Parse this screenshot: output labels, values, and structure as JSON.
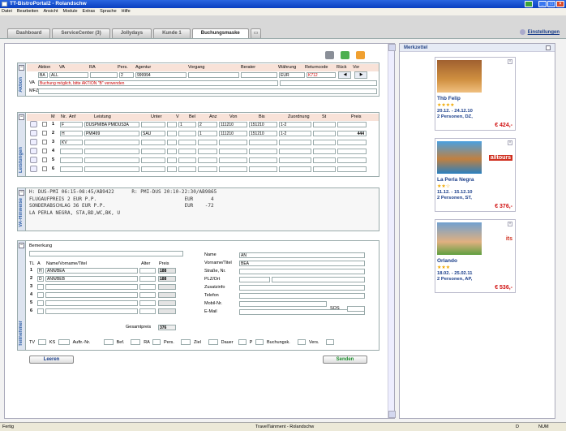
{
  "window": {
    "title": "TT-BistroPortal2 - Rolandschw"
  },
  "menu": [
    "Datei",
    "Bearbeiten",
    "Ansicht",
    "Module",
    "Extras",
    "Sprache",
    "Hilfe"
  ],
  "tabs": [
    "Dashboard",
    "ServiceCenter (3)",
    "Jollydays",
    "Kunde 1",
    "Buchungsmaske"
  ],
  "settings_label": "Einstellungen",
  "aktion": {
    "section_label": "Aktion",
    "headers": [
      "Aktion",
      "VA",
      "RA",
      "Pers.",
      "Agentur",
      "Vorgang",
      "Berater",
      "Währung",
      "Returncode",
      "Rück",
      "Vor"
    ],
    "row": {
      "aktion": "BA",
      "va": "ALL",
      "ra": "",
      "pers": "2",
      "agentur": "999994",
      "vorgang": "",
      "berater": "",
      "waehrung": "EUR",
      "returncode": "K712"
    },
    "va_label": "VA",
    "va_message": "Buchung möglich, bitte AKTION \"B\" verwenden",
    "mfz_label": "MFZ"
  },
  "leistungen": {
    "section_label": "Leistungen",
    "headers": [
      "M",
      "Nr.",
      "Anf",
      "Leistung",
      "Unter",
      "V",
      "Bel",
      "Anz",
      "Von",
      "Bis",
      "Zuordnung",
      "St",
      "Preis"
    ],
    "rows": [
      {
        "nr": "1",
        "anf": "F",
        "leistung": "DUSPMIBA PMIDUS3A",
        "unter": "",
        "bel": "1",
        "anz": "2",
        "von": "111210",
        "bis": "151210",
        "zuordnung": "1-2",
        "preis": ""
      },
      {
        "nr": "2",
        "anf": "H",
        "leistung": "PMI499",
        "unter": "SAU",
        "bel": "",
        "anz": "1",
        "von": "111210",
        "bis": "151210",
        "zuordnung": "1-2",
        "preis": "444"
      },
      {
        "nr": "3",
        "anf": "KV",
        "leistung": "",
        "unter": "",
        "bel": "",
        "anz": "",
        "von": "",
        "bis": "",
        "zuordnung": "",
        "preis": ""
      },
      {
        "nr": "4",
        "anf": "",
        "leistung": "",
        "unter": "",
        "bel": "",
        "anz": "",
        "von": "",
        "bis": "",
        "zuordnung": "",
        "preis": ""
      },
      {
        "nr": "5",
        "anf": "",
        "leistung": "",
        "unter": "",
        "bel": "",
        "anz": "",
        "von": "",
        "bis": "",
        "zuordnung": "",
        "preis": ""
      },
      {
        "nr": "6",
        "anf": "",
        "leistung": "",
        "unter": "",
        "bel": "",
        "anz": "",
        "von": "",
        "bis": "",
        "zuordnung": "",
        "preis": ""
      }
    ]
  },
  "hinweise": {
    "section_label": "VA-Hinweise",
    "lines": [
      "H: DUS-PMI 06:15-08:45/AB9422      R: PMI-DUS 20:10-22:30/AB9865",
      "FLUGAUFPREIS 2 EUR P.P.                              EUR      4",
      "SONDERABSCHLAG 36 EUR P.P.                           EUR    -72",
      "LA PERLA NEGRA, STA,BD,WC,BK, U"
    ]
  },
  "teilnehmer": {
    "section_label": "Teilnehmer",
    "bemerkung_label": "Bemerkung",
    "headers": [
      "TL",
      "A",
      "Name/Vorname/Titel",
      "Alter",
      "Preis"
    ],
    "rows": [
      {
        "tl": "1",
        "a": "H",
        "name": "ANN/BEA",
        "alter": "",
        "preis": "188"
      },
      {
        "tl": "2",
        "a": "D",
        "name": "ANN/BEB",
        "alter": "",
        "preis": "188"
      },
      {
        "tl": "3",
        "a": "",
        "name": "",
        "alter": "",
        "preis": ""
      },
      {
        "tl": "4",
        "a": "",
        "name": "",
        "alter": "",
        "preis": ""
      },
      {
        "tl": "5",
        "a": "",
        "name": "",
        "alter": "",
        "preis": ""
      },
      {
        "tl": "6",
        "a": "",
        "name": "",
        "alter": "",
        "preis": ""
      }
    ],
    "gesamtpreis_label": "Gesamtpreis",
    "gesamtpreis": "376",
    "contact": [
      {
        "label": "Name",
        "value": "AN"
      },
      {
        "label": "Vorname/Titel",
        "value": "BEA"
      },
      {
        "label": "Straße, Nr.",
        "value": ""
      },
      {
        "label": "PLZ/Ort",
        "value": ""
      },
      {
        "label": "Zusatzinfo",
        "value": ""
      },
      {
        "label": "Telefon",
        "value": ""
      },
      {
        "label": "Mobil-Nr.",
        "value": ""
      },
      {
        "label": "E-Mail",
        "value": ""
      }
    ],
    "sos_label": "SOS",
    "bottom": [
      "TV",
      "KS",
      "Auftr.-Nr.",
      "Bef.",
      "RA",
      "Pers.",
      "Ziel",
      "Dauer",
      "P",
      "Buchungsk.",
      "Vers."
    ]
  },
  "buttons": {
    "leeren": "Leeren",
    "senden": "Senden"
  },
  "merkzettel": {
    "title": "Merkzettel",
    "cards": [
      {
        "name": "Thb Felip",
        "stars": "★★★★",
        "dates": "20.12. - 24.12.10",
        "persons": "2 Personen, DZ,",
        "price": "€ 424,-",
        "logo": ""
      },
      {
        "name": "La Perla Negra",
        "stars": "★★☆",
        "dates": "11.12. - 15.12.10",
        "persons": "2 Personen, ST,",
        "price": "€ 376,-",
        "logo": "alltours"
      },
      {
        "name": "Orlando",
        "stars": "★★★",
        "dates": "18.02. - 25.02.11",
        "persons": "2 Personen, AP,",
        "price": "€ 536,-",
        "logo": "its"
      }
    ]
  },
  "status": {
    "left": "Fertig",
    "center": "TravelTainment - Rolandschw",
    "d": "D",
    "num": "NUM"
  }
}
